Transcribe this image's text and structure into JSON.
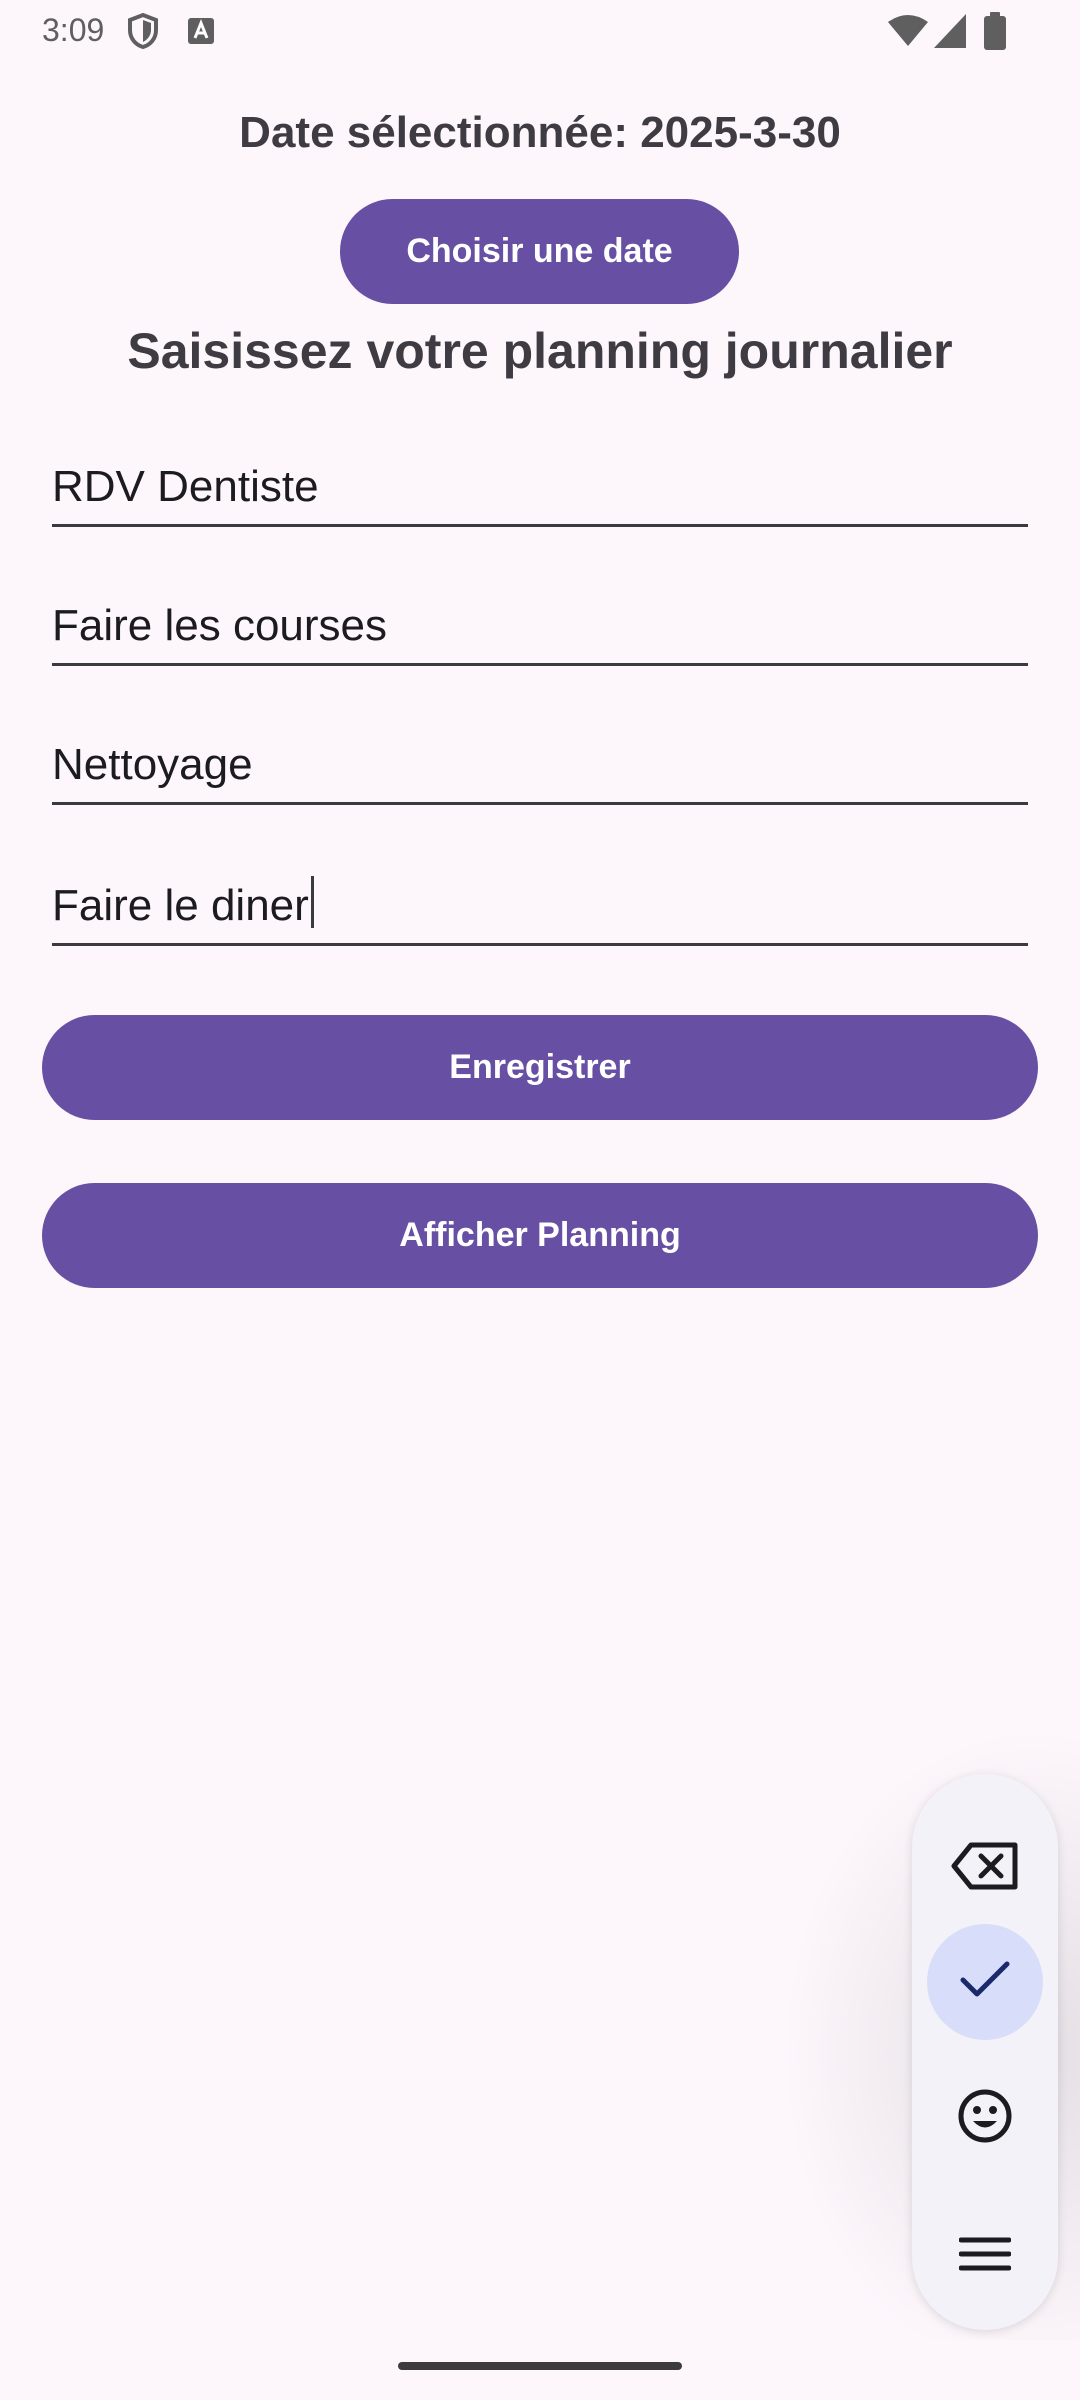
{
  "status_bar": {
    "time": "3:09",
    "left_icons": [
      "shield-icon",
      "keyboard-a-icon"
    ],
    "right_icons": [
      "wifi-icon",
      "signal-icon",
      "battery-icon"
    ]
  },
  "header": {
    "date_label": "Date sélectionnée: 2025-3-30",
    "choose_date_button": "Choisir une date",
    "section_title": "Saisissez votre planning journalier"
  },
  "form": {
    "fields": [
      {
        "value": "RDV Dentiste"
      },
      {
        "value": "Faire les courses"
      },
      {
        "value": "Nettoyage"
      },
      {
        "value": "Faire le diner",
        "focused": true
      }
    ]
  },
  "actions": {
    "save_button": "Enregistrer",
    "show_button": "Afficher Planning"
  },
  "keyboard_toolbar": {
    "keys": [
      "backspace-icon",
      "check-icon",
      "emoji-icon",
      "menu-icon"
    ],
    "active_key": "check-icon"
  },
  "colors": {
    "primary": "#6750a4",
    "background": "#fdf7fc",
    "text": "#3e3c42",
    "active_key_bg": "#d8def9"
  }
}
